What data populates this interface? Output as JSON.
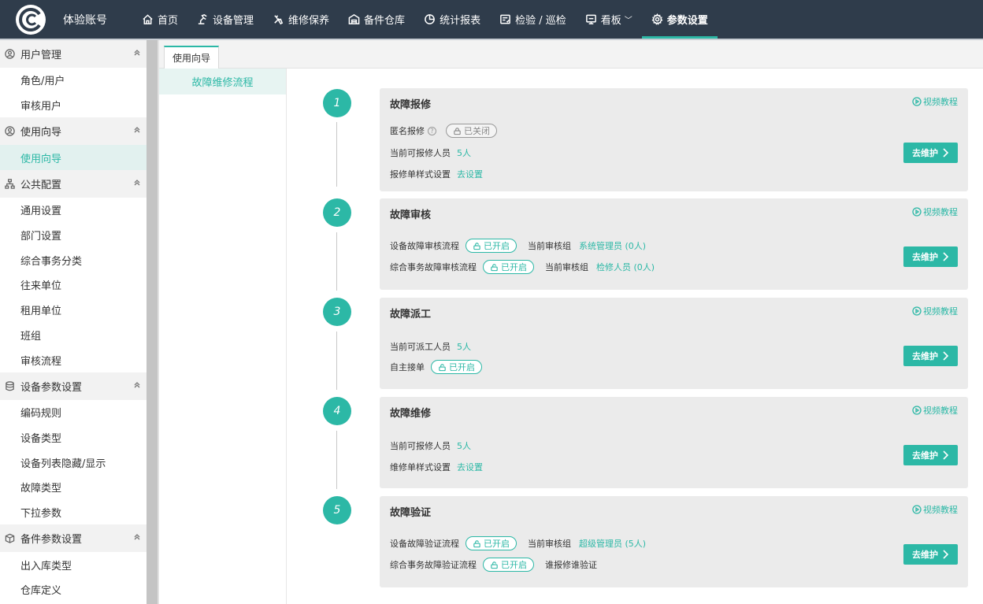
{
  "header": {
    "account": "体验账号",
    "nav": [
      {
        "label": "首页",
        "icon": "home-icon"
      },
      {
        "label": "设备管理",
        "icon": "robot-arm-icon"
      },
      {
        "label": "维修保养",
        "icon": "tools-icon"
      },
      {
        "label": "备件仓库",
        "icon": "warehouse-icon"
      },
      {
        "label": "统计报表",
        "icon": "pie-chart-icon"
      },
      {
        "label": "检验 / 巡检",
        "icon": "inspection-icon"
      },
      {
        "label": "看板",
        "icon": "monitor-icon"
      },
      {
        "label": "参数设置",
        "icon": "gear-icon",
        "active": true
      }
    ]
  },
  "sidebar": {
    "groups": [
      {
        "label": "用户管理",
        "icon": "user-circle-icon",
        "items": [
          "角色/用户",
          "审核用户"
        ]
      },
      {
        "label": "使用向导",
        "icon": "user-circle-icon",
        "items": [
          "使用向导"
        ]
      },
      {
        "label": "公共配置",
        "icon": "org-tree-icon",
        "items": [
          "通用设置",
          "部门设置",
          "综合事务分类",
          "往来单位",
          "租用单位",
          "班组",
          "审核流程"
        ]
      },
      {
        "label": "设备参数设置",
        "icon": "database-icon",
        "items": [
          "编码规则",
          "设备类型",
          "设备列表隐藏/显示",
          "故障类型",
          "下拉参数"
        ]
      },
      {
        "label": "备件参数设置",
        "icon": "box-icon",
        "items": [
          "出入库类型",
          "仓库定义"
        ]
      }
    ],
    "active_item": "使用向导"
  },
  "tabs": {
    "active": "使用向导"
  },
  "submenu": {
    "active": "故障维修流程"
  },
  "common": {
    "video": "视频教程",
    "maintain": "去维护",
    "on": "已开启",
    "off": "已关闭"
  },
  "steps": {
    "s1": {
      "num": "1",
      "title": "故障报修",
      "anon": "匿名报修",
      "cur": "当前可报修人员",
      "cur_val": "5人",
      "style": "报修单样式设置",
      "style_val": "去设置"
    },
    "s2": {
      "num": "2",
      "title": "故障审核",
      "r1": "设备故障审核流程",
      "r1_grp": "当前审核组",
      "r1_val": "系统管理员 (0人)",
      "r2": "综合事务故障审核流程",
      "r2_grp": "当前审核组",
      "r2_val": "检修人员 (0人)"
    },
    "s3": {
      "num": "3",
      "title": "故障派工",
      "cur": "当前可派工人员",
      "cur_val": "5人",
      "self": "自主接单"
    },
    "s4": {
      "num": "4",
      "title": "故障维修",
      "cur": "当前可报修人员",
      "cur_val": "5人",
      "style": "维修单样式设置",
      "style_val": "去设置"
    },
    "s5": {
      "num": "5",
      "title": "故障验证",
      "r1": "设备故障验证流程",
      "r1_grp": "当前审核组",
      "r1_val": "超级管理员 (5人)",
      "r2": "综合事务故障验证流程",
      "r2_note": "谁报修谁验证"
    }
  },
  "colors": {
    "accent": "#2cb8a6",
    "topbar": "#2f3c4b"
  }
}
